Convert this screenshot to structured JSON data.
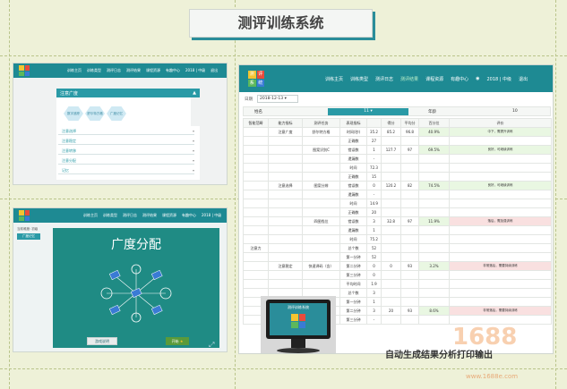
{
  "page_title": "测评训练系统",
  "caption": "自动生成结果分析打印输出",
  "watermark": {
    "brand": "1688",
    "url": "www.1688e.com"
  },
  "colors": {
    "teal": "#1e8a93",
    "bg": "#eef1d8"
  },
  "panel_top_left": {
    "logo_chars": [
      "测",
      "评",
      "系",
      "统"
    ],
    "nav": [
      "训练主页",
      "训练类型",
      "测评日志",
      "测评结果",
      "课程资源",
      "有趣中心",
      "2018 | 中级",
      "退出"
    ],
    "accordion_open": "注意广度",
    "hexes": [
      "数字追踪",
      "舒尔特方格",
      "广度记忆"
    ],
    "accordion_items": [
      "注意选择",
      "注意稳定",
      "注意转移",
      "注意分配",
      "记忆"
    ]
  },
  "panel_bottom_left": {
    "logo_chars": [
      "测",
      "评",
      "系",
      "统"
    ],
    "nav": [
      "训练主页",
      "训练类型",
      "测评日志",
      "测评结果",
      "课程资源",
      "有趣中心",
      "2018 | 中级",
      "退出"
    ],
    "level_label": "当前难度: 初级",
    "level_btn": "广度记忆",
    "game_title": "广度分配",
    "btn_help": "游戏说明",
    "btn_start": "开始"
  },
  "panel_right": {
    "logo_chars": [
      "测",
      "评",
      "系",
      "统"
    ],
    "nav": [
      "训练主页",
      "训练类型",
      "测评日志",
      "测评结果",
      "课程资源",
      "有趣中心",
      "2018 | 中级",
      "退出"
    ],
    "date_label": "日期",
    "date_value": "2018-12-13",
    "name_label": "姓名",
    "month_label": "11",
    "age_label": "年龄",
    "age_value": "10",
    "headers": [
      "智能范畴",
      "能力指标",
      "测评任务",
      "表现指标",
      "",
      "得分",
      "平均分",
      "百分位",
      "评价"
    ],
    "rows": [
      {
        "c1": "",
        "c2": "注意广度",
        "c3": "舒尔特方格",
        "c4": "时间(秒)",
        "v": "35.2",
        "score": "85.2",
        "avg": "96.8",
        "pct": "40.9%",
        "pval": 40.9,
        "eval": "中下，需提升训练"
      },
      {
        "c1": "",
        "c2": "",
        "c3": "",
        "c4": "正确数",
        "v": "27",
        "score": "",
        "avg": "",
        "pct": "",
        "pval": 0,
        "eval": ""
      },
      {
        "c1": "",
        "c2": "",
        "c3": "图案识别C",
        "c4": "错误数",
        "v": "1",
        "score": "127.7",
        "avg": "97",
        "pct": "69.5%",
        "pval": 69.5,
        "eval": "良好，可继续训练"
      },
      {
        "c1": "",
        "c2": "",
        "c3": "",
        "c4": "遗漏数",
        "v": "-",
        "score": "",
        "avg": "",
        "pct": "",
        "pval": 0,
        "eval": ""
      },
      {
        "c1": "",
        "c2": "",
        "c3": "",
        "c4": "时间",
        "v": "72.3",
        "score": "",
        "avg": "",
        "pct": "",
        "pval": 0,
        "eval": ""
      },
      {
        "c1": "",
        "c2": "",
        "c3": "",
        "c4": "正确数",
        "v": "15",
        "score": "",
        "avg": "",
        "pct": "",
        "pval": 0,
        "eval": ""
      },
      {
        "c1": "",
        "c2": "注意选择",
        "c3": "图案分辨",
        "c4": "错误数",
        "v": "0",
        "score": "120.2",
        "avg": "82",
        "pct": "74.5%",
        "pval": 74.5,
        "eval": "良好，可继续训练"
      },
      {
        "c1": "",
        "c2": "",
        "c3": "",
        "c4": "遗漏数",
        "v": "-",
        "score": "",
        "avg": "",
        "pct": "",
        "pval": 0,
        "eval": ""
      },
      {
        "c1": "",
        "c2": "",
        "c3": "",
        "c4": "时间",
        "v": "14.9",
        "score": "",
        "avg": "",
        "pct": "",
        "pval": 0,
        "eval": ""
      },
      {
        "c1": "",
        "c2": "",
        "c3": "",
        "c4": "正确数",
        "v": "20",
        "score": "",
        "avg": "",
        "pct": "",
        "pval": 0,
        "eval": ""
      },
      {
        "c1": "",
        "c2": "",
        "c3": "四图找位",
        "c4": "错误数",
        "v": "3",
        "score": "32.8",
        "avg": "97",
        "pct": "11.9%",
        "pval": 11.9,
        "eval": "落后，需加强训练"
      },
      {
        "c1": "",
        "c2": "",
        "c3": "",
        "c4": "遗漏数",
        "v": "1",
        "score": "",
        "avg": "",
        "pct": "",
        "pval": 0,
        "eval": ""
      },
      {
        "c1": "",
        "c2": "",
        "c3": "",
        "c4": "时间",
        "v": "75.2",
        "score": "",
        "avg": "",
        "pct": "",
        "pval": 0,
        "eval": ""
      },
      {
        "c1": "注意力",
        "c2": "",
        "c3": "",
        "c4": "总个数",
        "v": "52",
        "score": "",
        "avg": "",
        "pct": "",
        "pval": 0,
        "eval": ""
      },
      {
        "c1": "",
        "c2": "",
        "c3": "",
        "c4": "第一分钟",
        "v": "52",
        "score": "",
        "avg": "",
        "pct": "",
        "pval": 0,
        "eval": ""
      },
      {
        "c1": "",
        "c2": "注意稳定",
        "c3": "快速译码（含）",
        "c4": "第二分钟",
        "v": "0",
        "score": "0",
        "avg": "93",
        "pct": "3.2%",
        "pval": 3.2,
        "eval": "非常落后，需要持续训练"
      },
      {
        "c1": "",
        "c2": "",
        "c3": "",
        "c4": "第三分钟",
        "v": "0",
        "score": "",
        "avg": "",
        "pct": "",
        "pval": 0,
        "eval": ""
      },
      {
        "c1": "",
        "c2": "",
        "c3": "",
        "c4": "平均时间",
        "v": "1.9",
        "score": "",
        "avg": "",
        "pct": "",
        "pval": 0,
        "eval": ""
      },
      {
        "c1": "",
        "c2": "",
        "c3": "",
        "c4": "总个数",
        "v": "3",
        "score": "",
        "avg": "",
        "pct": "",
        "pval": 0,
        "eval": ""
      },
      {
        "c1": "",
        "c2": "",
        "c3": "",
        "c4": "第一分钟",
        "v": "1",
        "score": "",
        "avg": "",
        "pct": "",
        "pval": 0,
        "eval": ""
      },
      {
        "c1": "",
        "c2": "",
        "c3": "",
        "c4": "第二分钟",
        "v": "3",
        "score": "20",
        "avg": "93",
        "pct": "8.6%",
        "pval": 8.6,
        "eval": "非常落后，需要持续训练"
      },
      {
        "c1": "",
        "c2": "",
        "c3": "",
        "c4": "第三分钟",
        "v": "-",
        "score": "",
        "avg": "",
        "pct": "",
        "pval": 0,
        "eval": ""
      }
    ]
  },
  "device": {
    "screen_title": "测评训练系统"
  }
}
